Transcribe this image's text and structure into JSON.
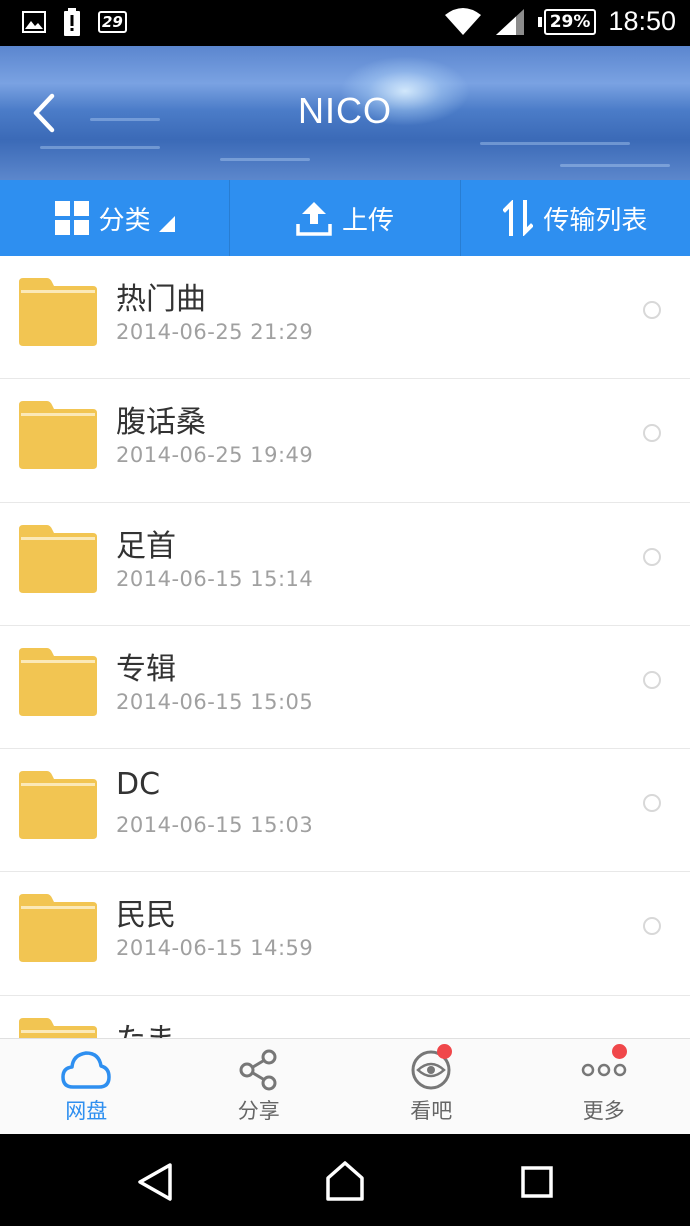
{
  "status_bar": {
    "time": "18:50",
    "battery": "29%",
    "notification_count": "29",
    "icons": [
      "image-icon",
      "battery-alert-icon",
      "notification-icon",
      "wifi-icon",
      "signal-icon",
      "battery-icon"
    ]
  },
  "header": {
    "title": "NICO",
    "back_icon": "chevron-left-icon"
  },
  "toolbar": {
    "category_label": "分类",
    "upload_label": "上传",
    "transfer_label": "传输列表"
  },
  "files": [
    {
      "name": "热门曲",
      "date": "2014-06-25  21:29"
    },
    {
      "name": "腹话桑",
      "date": "2014-06-25  19:49"
    },
    {
      "name": "足首",
      "date": "2014-06-15  15:14"
    },
    {
      "name": "专辑",
      "date": "2014-06-15  15:05"
    },
    {
      "name": "DC",
      "date": "2014-06-15  15:03"
    },
    {
      "name": "民民",
      "date": "2014-06-15  14:59"
    },
    {
      "name": "たま",
      "date": ""
    }
  ],
  "tabs": [
    {
      "label": "网盘",
      "icon": "cloud-icon",
      "active": true,
      "badge": false
    },
    {
      "label": "分享",
      "icon": "share-icon",
      "active": false,
      "badge": false
    },
    {
      "label": "看吧",
      "icon": "eye-icon",
      "active": false,
      "badge": true
    },
    {
      "label": "更多",
      "icon": "more-icon",
      "active": false,
      "badge": true
    }
  ],
  "colors": {
    "accent": "#2e8ff0",
    "folder": "#f2c552",
    "badge": "#f0474a"
  }
}
